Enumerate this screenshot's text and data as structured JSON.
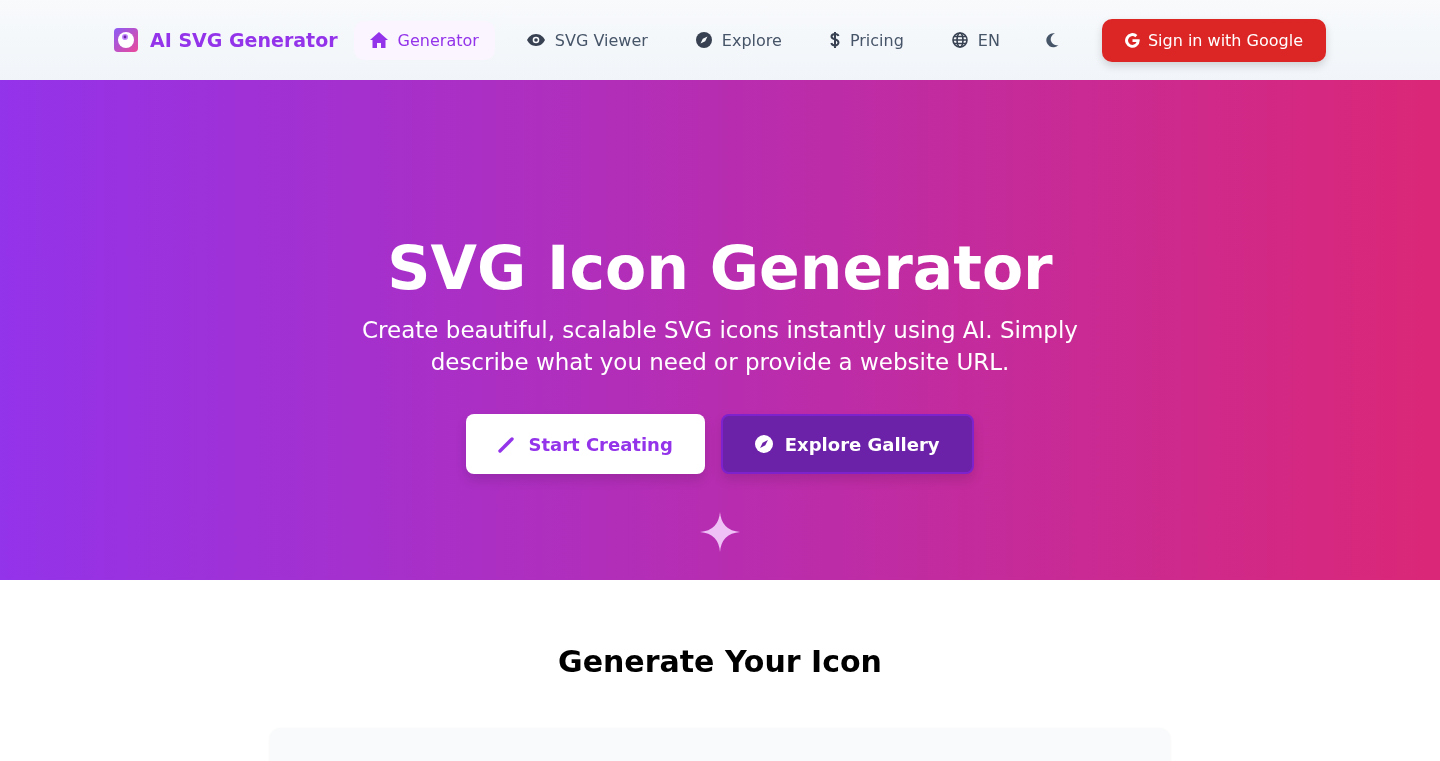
{
  "brand": {
    "name": "AI SVG Generator"
  },
  "nav": [
    {
      "label": "Generator",
      "selected": true
    },
    {
      "label": "SVG Viewer",
      "selected": false
    },
    {
      "label": "Explore",
      "selected": false
    },
    {
      "label": "Pricing",
      "selected": false
    }
  ],
  "language": {
    "label": "EN"
  },
  "sign_in": {
    "label": "Sign in with Google"
  },
  "hero": {
    "title": "SVG Icon Generator",
    "subtitle": "Create beautiful, scalable SVG icons instantly using AI. Simply describe what you need or provide a website URL.",
    "buttons": [
      {
        "label": "Start Creating",
        "kind": "primary"
      },
      {
        "label": "Explore Gallery",
        "kind": "secondary"
      }
    ]
  },
  "generator": {
    "heading": "Generate Your Icon"
  }
}
